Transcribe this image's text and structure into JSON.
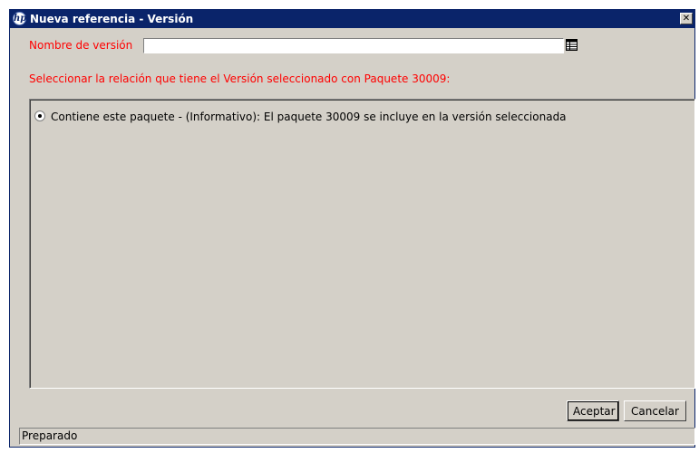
{
  "window": {
    "title": "Nueva referencia - Versión",
    "close_glyph": "✕",
    "logo_glyph": "hp"
  },
  "form": {
    "name_label": "Nombre de versión",
    "name_value": "",
    "relation_prompt": "Seleccionar la relación que tiene el Versión seleccionado con Paquete 30009:"
  },
  "options": [
    {
      "label": "Contiene este paquete - (Informativo): El paquete 30009 se incluye en la versión seleccionada",
      "selected": true
    }
  ],
  "buttons": {
    "ok": "Aceptar",
    "cancel": "Cancelar"
  },
  "status": {
    "text": "Preparado"
  },
  "icons": {
    "app_logo": "hp-logo-icon",
    "list_picker": "list-picker-icon",
    "close": "close-icon"
  },
  "colors": {
    "title_bar": "#0a246a",
    "label_red": "#ff0000",
    "window_bg": "#d4d0c8"
  }
}
